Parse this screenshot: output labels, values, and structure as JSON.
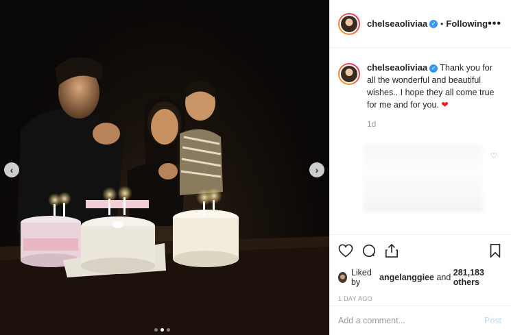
{
  "post": {
    "username": "chelseaoliviaa",
    "verified_mark": "✓",
    "separator": "•",
    "follow_status": "Following",
    "more_label": "•••",
    "caption": "Thank you for all the wonderful and beautiful wishes.. I hope they all come true for me and for you.",
    "caption_emoji": "❤",
    "caption_age": "1d",
    "liked_by_prefix": "Liked by",
    "liked_by_user": "angelanggiee",
    "liked_by_and": "and",
    "likes_count": "281,183 others",
    "date": "1 DAY AGO",
    "comment_placeholder": "Add a comment...",
    "post_label": "Post"
  },
  "carousel": {
    "prev_label": "‹",
    "next_label": "›",
    "current_index": 2,
    "total": 3
  },
  "icons": [
    "heart-icon",
    "comment-icon",
    "share-icon",
    "bookmark-icon",
    "like-comment-heart-icon",
    "more-icon",
    "chevron-left-icon",
    "chevron-right-icon"
  ],
  "colors": {
    "verified": "#3897f0",
    "post_disabled": "#b2dffc",
    "heart": "#ed1c24",
    "muted": "#999999"
  }
}
